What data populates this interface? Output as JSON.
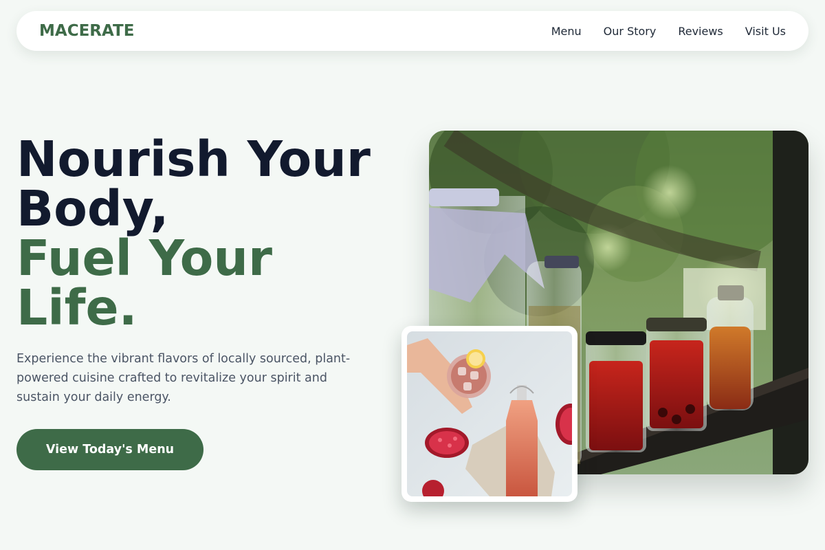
{
  "brand": {
    "name": "MACERATE",
    "color": "#3e6b48"
  },
  "nav": {
    "items": [
      {
        "label": "Menu"
      },
      {
        "label": "Our Story"
      },
      {
        "label": "Reviews"
      },
      {
        "label": "Visit Us"
      }
    ]
  },
  "hero": {
    "title_lines": [
      "Nourish Your",
      "Body,"
    ],
    "accent_lines": [
      "Fuel Your",
      "Life."
    ],
    "subtitle": "Experience the vibrant flavors of locally sourced, plant-powered cuisine crafted to revitalize your spirit and sustain your daily energy.",
    "cta_label": "View Today's Menu"
  },
  "images": {
    "main": "jars-of-fermented-drinks-photo",
    "inset": "pomegranate-drink-photo"
  },
  "colors": {
    "background": "#f4f8f5",
    "heading": "#121a2e",
    "accent": "#3e6b48",
    "body_text": "#4b5565"
  }
}
